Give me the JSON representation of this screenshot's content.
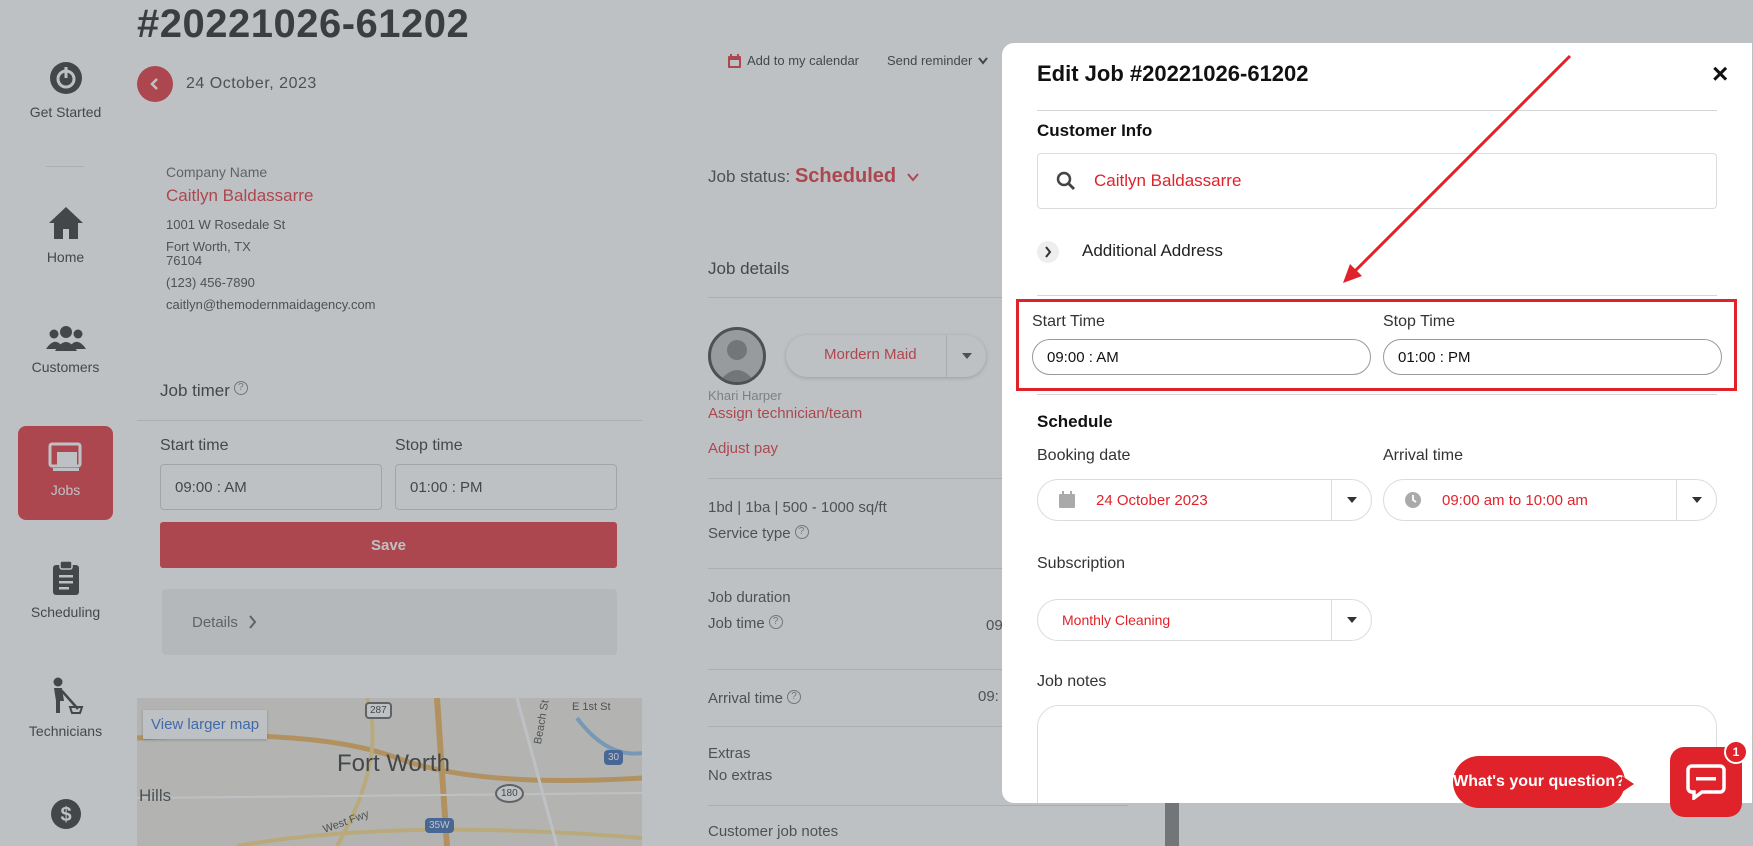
{
  "sidebar": {
    "items": [
      {
        "label": "Get Started",
        "icon": "power-icon"
      },
      {
        "label": "Home",
        "icon": "home-icon"
      },
      {
        "label": "Customers",
        "icon": "users-icon"
      },
      {
        "label": "Jobs",
        "icon": "jobs-icon",
        "active": true
      },
      {
        "label": "Scheduling",
        "icon": "clipboard-icon"
      },
      {
        "label": "Technicians",
        "icon": "technician-icon"
      },
      {
        "label": "",
        "icon": "dollar-icon"
      }
    ]
  },
  "page": {
    "title": "#20221026-61202",
    "date": "24 October, 2023",
    "add_calendar": "Add to my calendar",
    "send_reminder": "Send reminder"
  },
  "customer_card": {
    "company_label": "Company Name",
    "name": "Caitlyn Baldassarre",
    "address1": "1001 W Rosedale St",
    "address2": "Fort Worth, TX",
    "zip": "76104",
    "phone": "(123) 456-7890",
    "email": "caitlyn@themodernmaidagency.com"
  },
  "job_timer": {
    "title": "Job timer",
    "start_label": "Start time",
    "stop_label": "Stop time",
    "start_value": "09:00 : AM",
    "stop_value": "01:00 : PM",
    "save": "Save",
    "details": "Details"
  },
  "map": {
    "view_larger": "View larger map",
    "city": "Fort Worth",
    "hills": "Hills",
    "street": "E 1st St",
    "road_beach": "Beach St",
    "fwy": "West Fwy",
    "shield_287": "287",
    "shield_30": "30",
    "shield_180": "180",
    "shield_35w": "35W"
  },
  "job_status": {
    "label": "Job status:",
    "value": "Scheduled"
  },
  "job_details": {
    "title": "Job details",
    "team": "Mordern Maid",
    "technician": "Khari Harper",
    "assign": "Assign technician/team",
    "adjust_pay": "Adjust pay",
    "service": "1bd | 1ba | 500 - 1000 sq/ft",
    "service_type": "Service type",
    "duration_label": "Job duration",
    "job_time": "Job time",
    "job_time_value": "09",
    "arrival_label": "Arrival time",
    "arrival_value": "09:",
    "extras_label": "Extras",
    "extras_value": "No extras",
    "customer_notes": "Customer job notes"
  },
  "modal": {
    "title": "Edit Job #20221026-61202",
    "close": "×",
    "customer_info": "Customer Info",
    "customer_value": "Caitlyn Baldassarre",
    "additional_address": "Additional Address",
    "start_time_label": "Start Time",
    "stop_time_label": "Stop Time",
    "start_time_value": "09:00 : AM",
    "stop_time_value": "01:00 : PM",
    "schedule": "Schedule",
    "booking_date_label": "Booking date",
    "booking_date_value": "24 October 2023",
    "arrival_time_label": "Arrival time",
    "arrival_time_value": "09:00 am to 10:00 am",
    "subscription_label": "Subscription",
    "subscription_value": "Monthly Cleaning",
    "job_notes_label": "Job notes"
  },
  "chat": {
    "question": "What's your question?",
    "badge": "1"
  },
  "colors": {
    "accent": "#e0222a",
    "annotation": "#e0222a"
  }
}
